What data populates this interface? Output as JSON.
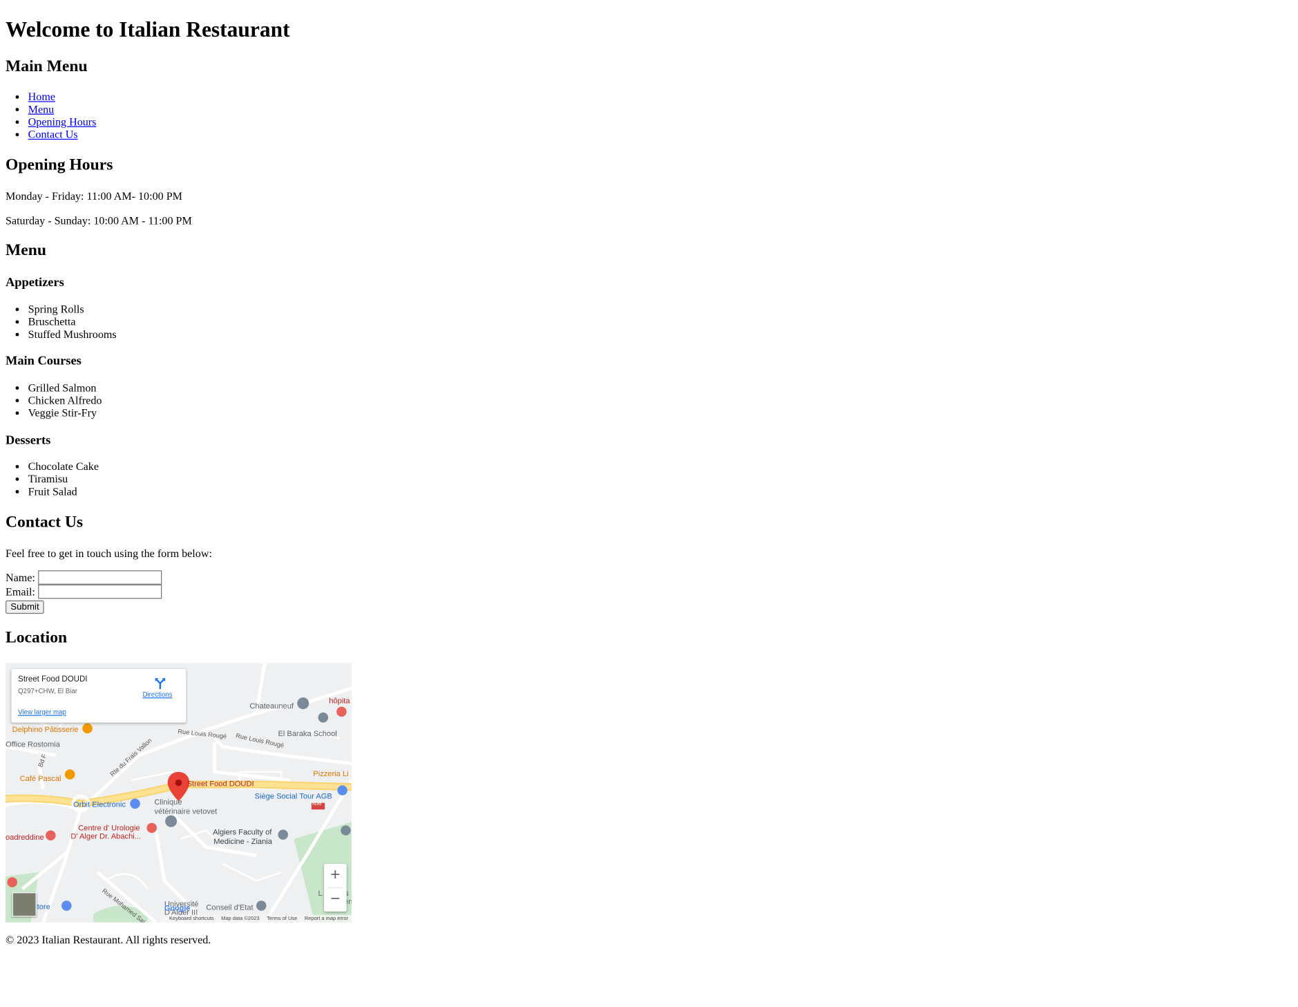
{
  "header": {
    "title": "Welcome to Italian Restaurant"
  },
  "nav": {
    "heading": "Main Menu",
    "items": [
      "Home",
      "Menu",
      "Opening Hours",
      "Contact Us"
    ]
  },
  "hours": {
    "heading": "Opening Hours",
    "weekdays": "Monday - Friday: 11:00 AM- 10:00 PM",
    "weekend": "Saturday - Sunday: 10:00 AM - 11:00 PM"
  },
  "menu": {
    "heading": "Menu",
    "sections": [
      {
        "title": "Appetizers",
        "items": [
          "Spring Rolls",
          "Bruschetta",
          "Stuffed Mushrooms"
        ]
      },
      {
        "title": "Main Courses",
        "items": [
          "Grilled Salmon",
          "Chicken Alfredo",
          "Veggie Stir-Fry"
        ]
      },
      {
        "title": "Desserts",
        "items": [
          "Chocolate Cake",
          "Tiramisu",
          "Fruit Salad"
        ]
      }
    ]
  },
  "contact": {
    "heading": "Contact Us",
    "intro": "Feel free to get in touch using the form below:",
    "name_label": "Name:",
    "email_label": "Email:",
    "name_value": "",
    "email_value": "",
    "submit_label": "Submit"
  },
  "location": {
    "heading": "Location",
    "map": {
      "place_name": "Street Food DOUDI",
      "address": "Q297+CHW, El Biar",
      "directions_label": "Directions",
      "larger_map_label": "View larger map",
      "labels": {
        "chateauneuf": "Chateauneuf",
        "hopital": "hôpita",
        "delphino": "Delphino Pâtisserie",
        "rue_louis_rouge_1": "Rue Louis Rougé",
        "rue_louis_rouge_2": "Rue Louis Rougé",
        "el_baraka": "El Baraka School",
        "office": "Office Rostomia",
        "frais_vallon": "Rte du Frais Vallon",
        "bd": "Bd F",
        "pizzeria": "Pizzeria Li",
        "cafe_pascal": "Café Pascal",
        "street_food_pin": "Street Food DOUDI",
        "siege": "Siège Social Tour AGB",
        "n36": "N36",
        "orbit": "Orbit Electronic",
        "clinique_1": "Clinique",
        "clinique_2": "vétérinaire vetovet",
        "urologie_1": "Centre d' Urologie",
        "urologie_2": "D' Alger Dr. Abachi...",
        "algiers_1": "Algiers Faculty of",
        "algiers_2": "Medicine - Ziania",
        "boadreddine": "oadreddine",
        "store": "it store",
        "mohamed": "Rue Mohamed Sai",
        "universite_1": "Université",
        "universite_2": "D'Alger III",
        "conseil": "Conseil d'Etat",
        "edge_l": "L",
        "edge_s": "s",
        "edge_en": "en"
      },
      "google_logo": "Google",
      "attribution": [
        "Keyboard shortcuts",
        "Map data ©2023",
        "Terms of Use",
        "Report a map error"
      ],
      "zoom_in": "+",
      "zoom_out": "−",
      "colors": {
        "pin": "#ea4335",
        "road_major": "#fdd663",
        "park": "#c8e6c9",
        "base": "#eef0f2"
      },
      "icons": [
        "directions-icon",
        "map-pin-icon",
        "zoom-in-icon",
        "zoom-out-icon",
        "satellite-thumbnail"
      ]
    }
  },
  "footer": {
    "text": "© 2023 Italian Restaurant. All rights reserved."
  }
}
